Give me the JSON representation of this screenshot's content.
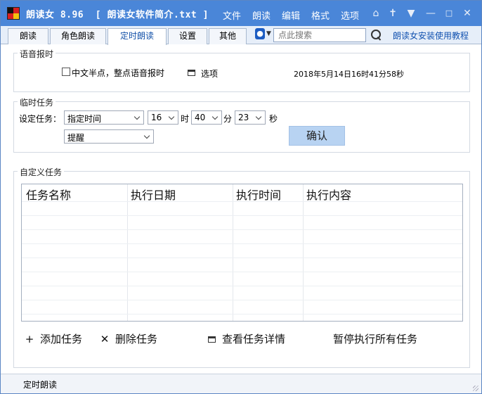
{
  "titlebar": {
    "app_title": "朗读女 8.96  [ 朗读女软件简介.txt ]",
    "menu": [
      "文件",
      "朗读",
      "编辑",
      "格式",
      "选项"
    ],
    "icons": [
      "home-icon",
      "pin-icon",
      "shirt-icon",
      "minimize-icon",
      "close-icon"
    ]
  },
  "tabs": [
    {
      "label": "朗读",
      "active": false
    },
    {
      "label": "角色朗读",
      "active": false
    },
    {
      "label": "定时朗读",
      "active": true
    },
    {
      "label": "设置",
      "active": false
    },
    {
      "label": "其他",
      "active": false
    }
  ],
  "search": {
    "placeholder": "点此搜索",
    "value": ""
  },
  "tutorial_link": "朗读女安装使用教程",
  "voice_report": {
    "legend": "语音报时",
    "checkbox_label": "中文半点，整点语音报时",
    "checked": false,
    "options_label": "选项",
    "datetime": "2018年5月14日16时41分58秒"
  },
  "temp_task": {
    "legend": "临时任务",
    "set_task_label": "设定任务：",
    "mode": "指定时间",
    "hour": "16",
    "hour_unit": "时",
    "minute": "40",
    "minute_unit": "分",
    "second": "23",
    "second_unit": "秒",
    "action": "提醒",
    "confirm_label": "确认"
  },
  "custom_tasks": {
    "legend": "自定义任务",
    "columns": [
      "任务名称",
      "执行日期",
      "执行时间",
      "执行内容"
    ],
    "rows": []
  },
  "actions": {
    "add": "添加任务",
    "delete": "删除任务",
    "details": "查看任务详情",
    "pause_all": "暂停执行所有任务"
  },
  "status": {
    "text": "定时朗读"
  },
  "colors": {
    "titlebar": "#4a86d8",
    "accent": "#1252b0",
    "confirm_bg": "#b8d3f2"
  }
}
